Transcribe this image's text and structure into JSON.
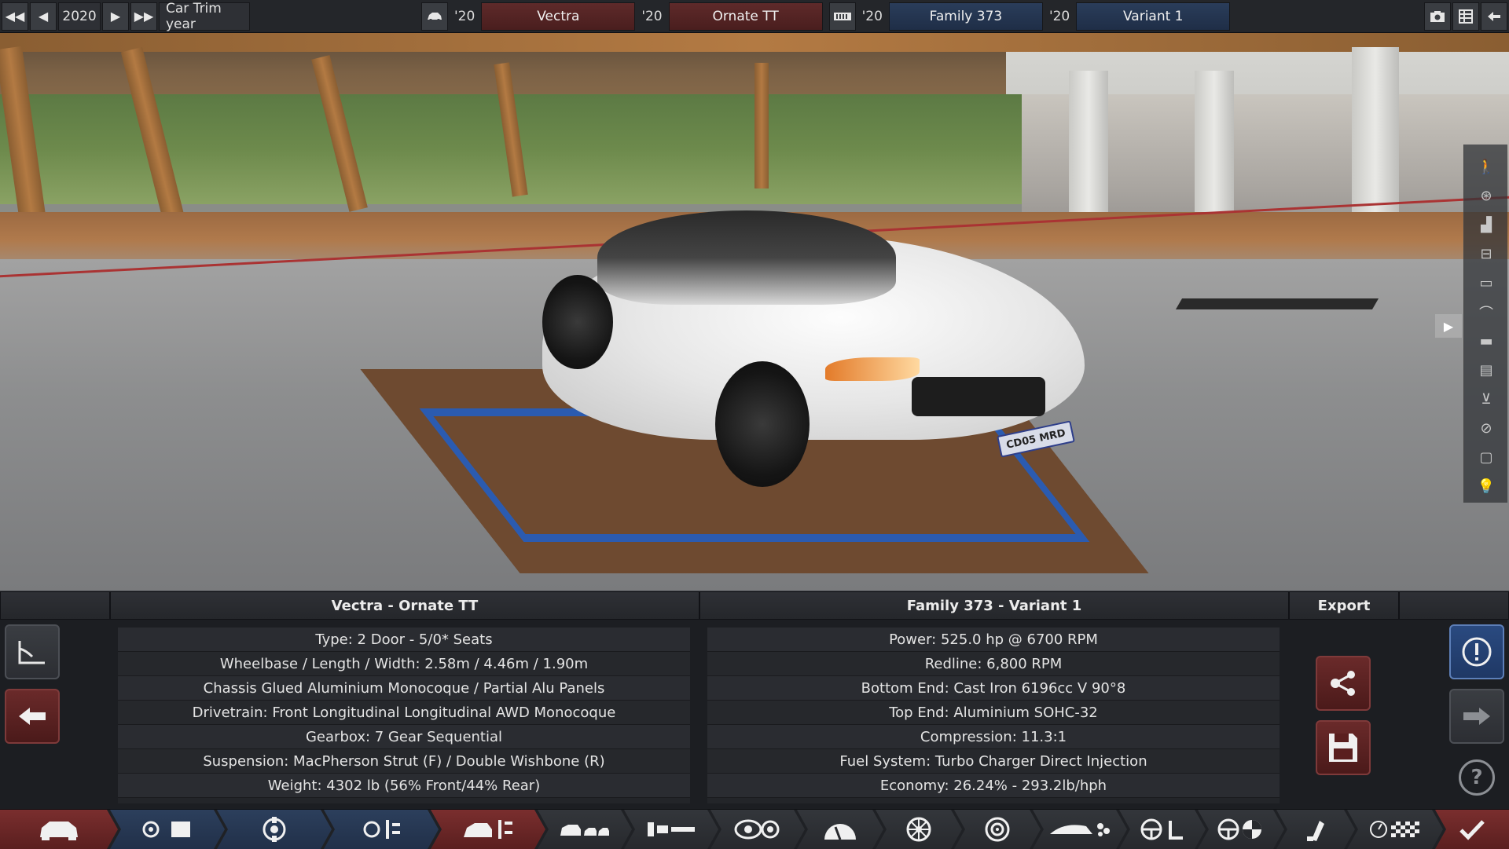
{
  "topbar": {
    "year": "2020",
    "year_label": "Car Trim year",
    "model": {
      "year": "'20",
      "name": "Vectra"
    },
    "trim": {
      "year": "'20",
      "name": "Ornate TT"
    },
    "family": {
      "year": "'20",
      "name": "Family 373"
    },
    "variant": {
      "year": "'20",
      "name": "Variant 1"
    }
  },
  "panel": {
    "car_title": "Vectra - Ornate TT",
    "engine_title": "Family 373 - Variant 1",
    "export_title": "Export",
    "car_specs": [
      "Type: 2 Door - 5/0* Seats",
      "Wheelbase / Length / Width: 2.58m / 4.46m / 1.90m",
      "Chassis Glued Aluminium Monocoque / Partial Alu Panels",
      "Drivetrain: Front Longitudinal Longitudinal AWD Monocoque",
      "Gearbox: 7 Gear Sequential",
      "Suspension: MacPherson Strut (F) / Double Wishbone (R)",
      "Weight: 4302 lb (56% Front/44% Rear)"
    ],
    "engine_specs": [
      "Power: 525.0 hp @ 6700 RPM",
      "Redline:  6,800 RPM",
      "Bottom End: Cast Iron 6196cc V 90°8",
      "Top End: Aluminium SOHC-32",
      "Compression: 11.3:1",
      "Fuel System: Turbo Charger Direct Injection",
      "Economy: 26.24% - 293.2lb/hph"
    ]
  },
  "scene": {
    "license_plate": "CD05 MRD"
  },
  "tabs": [
    "car-body-icon",
    "engine-family-icon",
    "engine-block-icon",
    "engine-parts-icon",
    "car-chassis-icon",
    "car-models-icon",
    "suspension-icon",
    "drivetrain-icon",
    "gearbox-icon",
    "wheels-icon",
    "brakes-icon",
    "aero-icon",
    "interior-icon",
    "steering-icon",
    "paint-icon",
    "testing-icon",
    "finish-icon"
  ],
  "colors": {
    "accent_red": "#7a2e2e",
    "accent_blue": "#2c3f5c",
    "panel_bg": "#1c1e22"
  }
}
